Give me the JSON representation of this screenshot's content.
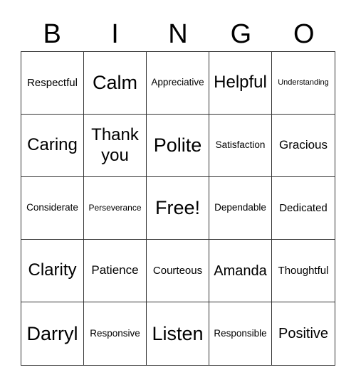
{
  "header": [
    "B",
    "I",
    "N",
    "G",
    "O"
  ],
  "cells": [
    "Respectful",
    "Calm",
    "Appreciative",
    "Helpful",
    "Understanding",
    "Caring",
    "Thank you",
    "Polite",
    "Satisfaction",
    "Gracious",
    "Considerate",
    "Perseverance",
    "Free!",
    "Dependable",
    "Dedicated",
    "Clarity",
    "Patience",
    "Courteous",
    "Amanda",
    "Thoughtful",
    "Darryl",
    "Responsive",
    "Listen",
    "Responsible",
    "Positive"
  ]
}
